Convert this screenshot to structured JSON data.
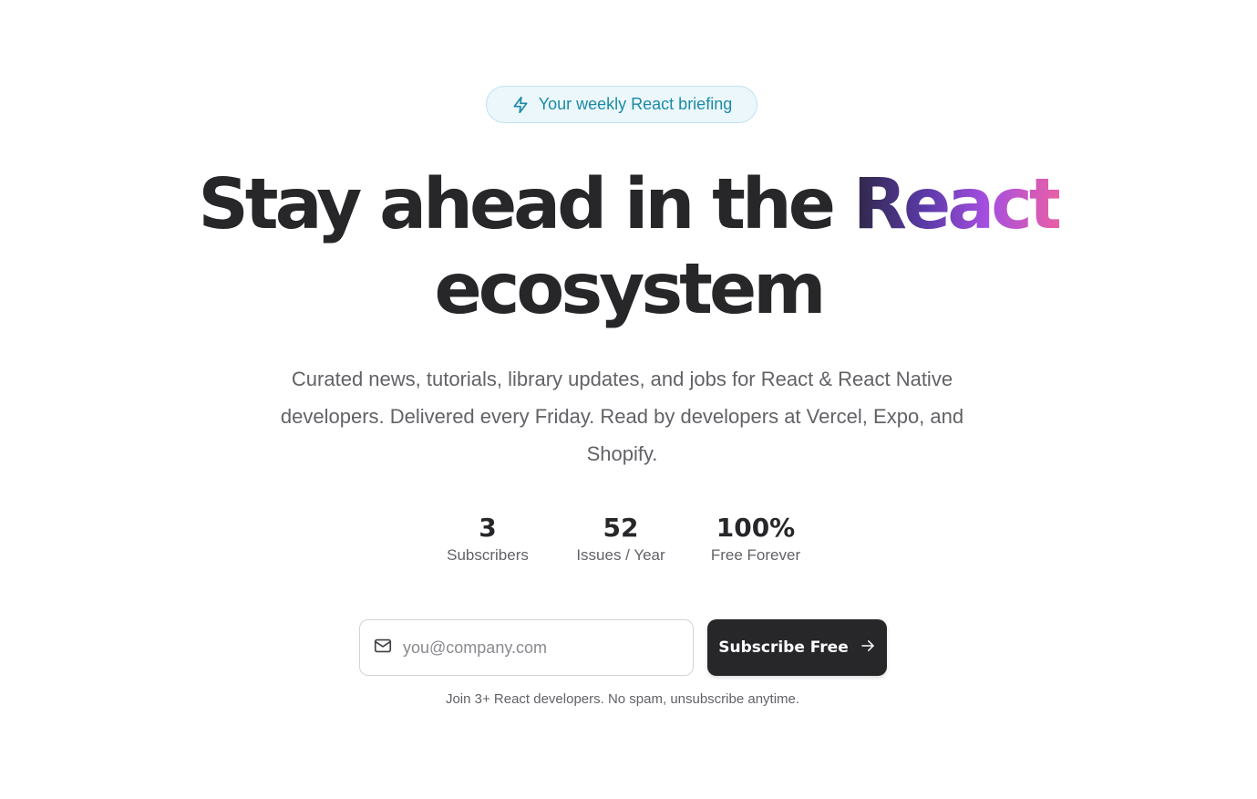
{
  "badge": {
    "icon": "lightning-bolt-icon",
    "label": "Your weekly React briefing"
  },
  "headline": {
    "line1_prefix": "Stay ahead in the ",
    "line1_accent": "React",
    "line2": "ecosystem"
  },
  "subtitle": "Curated news, tutorials, library updates, and jobs for React & React Native developers. Delivered every Friday. Read by developers at Vercel, Expo, and Shopify.",
  "stats": [
    {
      "value": "3",
      "label": "Subscribers"
    },
    {
      "value": "52",
      "label": "Issues / Year"
    },
    {
      "value": "100%",
      "label": "Free Forever"
    }
  ],
  "signup": {
    "email_icon": "mail-icon",
    "email_placeholder": "you@company.com",
    "email_value": "",
    "button_label": "Subscribe Free",
    "button_icon": "arrow-right-icon",
    "note": "Join 3+ React developers. No spam, unsubscribe anytime."
  },
  "colors": {
    "text_primary": "#27272a",
    "text_secondary": "#626267",
    "badge_text": "#1b8aa6",
    "badge_background": "#ecf7fb",
    "badge_border": "#bfe3ee",
    "accent_gradient": [
      "#2e2744",
      "#5b3aa8",
      "#a64fe0",
      "#e85fa6"
    ],
    "button_background": "#27272a"
  }
}
